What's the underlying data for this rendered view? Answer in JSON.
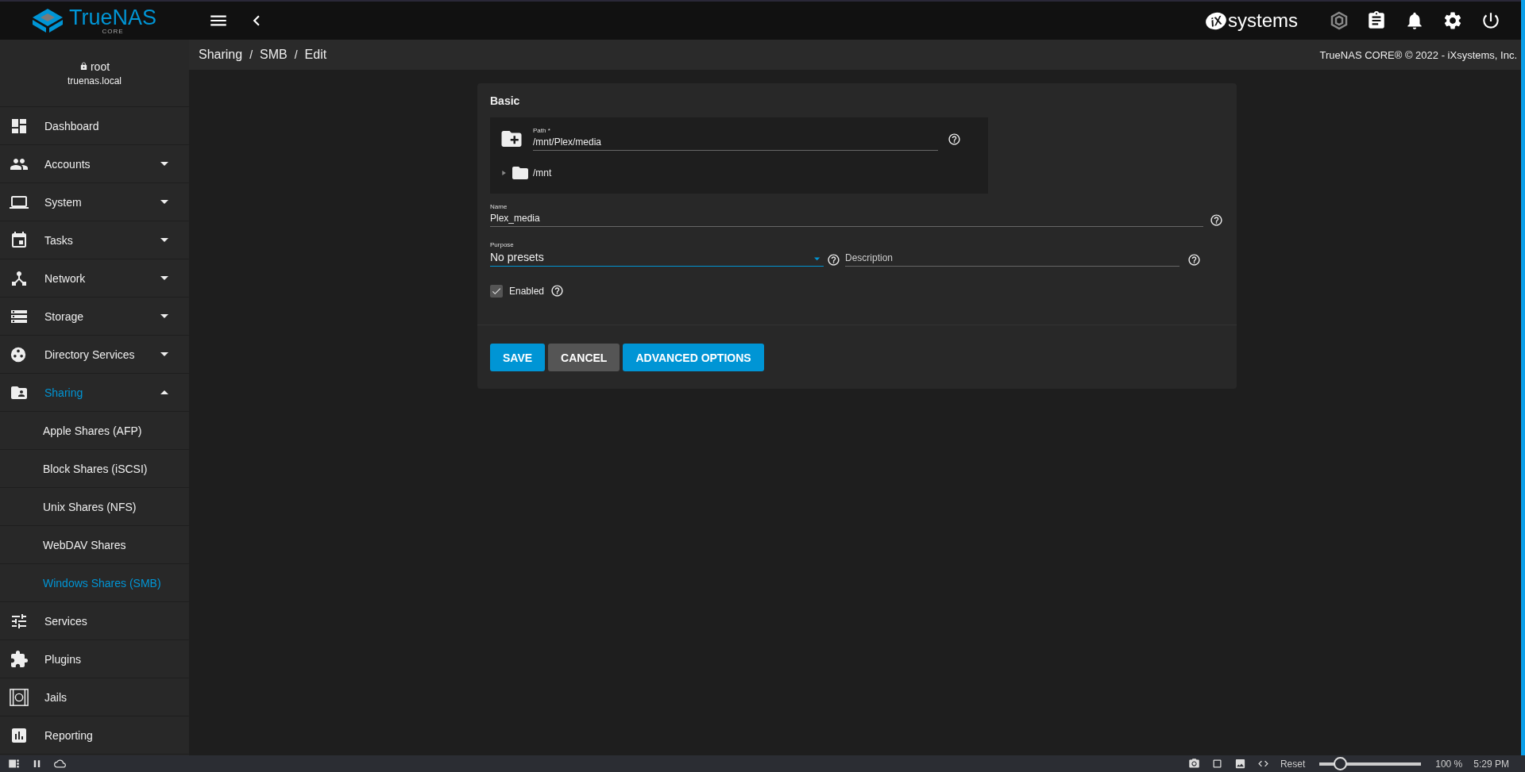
{
  "topbar": {
    "logo": {
      "name": "TrueNAS",
      "edition": "CORE"
    },
    "brand": {
      "mark": "iX",
      "name": "systems"
    }
  },
  "user": {
    "name": "root",
    "host": "truenas.local"
  },
  "breadcrumb": [
    "Sharing",
    "SMB",
    "Edit"
  ],
  "breadcrumb_separator": "/",
  "copyright": "TrueNAS CORE® © 2022 - iXsystems, Inc.",
  "sidebar": {
    "items": [
      {
        "label": "Dashboard",
        "kind": "link",
        "selected": false
      },
      {
        "label": "Accounts",
        "kind": "menu",
        "expanded": false,
        "selected": false
      },
      {
        "label": "System",
        "kind": "menu",
        "expanded": false,
        "selected": false
      },
      {
        "label": "Tasks",
        "kind": "menu",
        "expanded": false,
        "selected": false
      },
      {
        "label": "Network",
        "kind": "menu",
        "expanded": false,
        "selected": false
      },
      {
        "label": "Storage",
        "kind": "menu",
        "expanded": false,
        "selected": false
      },
      {
        "label": "Directory Services",
        "kind": "menu",
        "expanded": false,
        "selected": false
      },
      {
        "label": "Sharing",
        "kind": "menu",
        "expanded": true,
        "selected": true,
        "children": [
          {
            "label": "Apple Shares (AFP)",
            "selected": false
          },
          {
            "label": "Block Shares (iSCSI)",
            "selected": false
          },
          {
            "label": "Unix Shares (NFS)",
            "selected": false
          },
          {
            "label": "WebDAV Shares",
            "selected": false
          },
          {
            "label": "Windows Shares (SMB)",
            "selected": true
          }
        ]
      },
      {
        "label": "Services",
        "kind": "link",
        "selected": false
      },
      {
        "label": "Plugins",
        "kind": "link",
        "selected": false
      },
      {
        "label": "Jails",
        "kind": "link",
        "selected": false
      },
      {
        "label": "Reporting",
        "kind": "link",
        "selected": false
      }
    ]
  },
  "form": {
    "section": "Basic",
    "path": {
      "label": "Path *",
      "value": "/mnt/Plex/media",
      "tree": [
        {
          "label": "/mnt",
          "expanded": false
        }
      ]
    },
    "name": {
      "label": "Name",
      "value": "Plex_media"
    },
    "purpose": {
      "label": "Purpose",
      "value": "No presets"
    },
    "description": {
      "placeholder": "Description"
    },
    "enabled": {
      "label": "Enabled",
      "checked": true
    },
    "buttons": [
      {
        "label": "SAVE",
        "kind": "primary"
      },
      {
        "label": "CANCEL",
        "kind": "secondary"
      },
      {
        "label": "ADVANCED OPTIONS",
        "kind": "primary"
      }
    ]
  },
  "status_bar": {
    "reset": "Reset",
    "zoom": {
      "level": 0.2
    },
    "zoom_reading": "100 %",
    "time": "5:29 PM"
  }
}
